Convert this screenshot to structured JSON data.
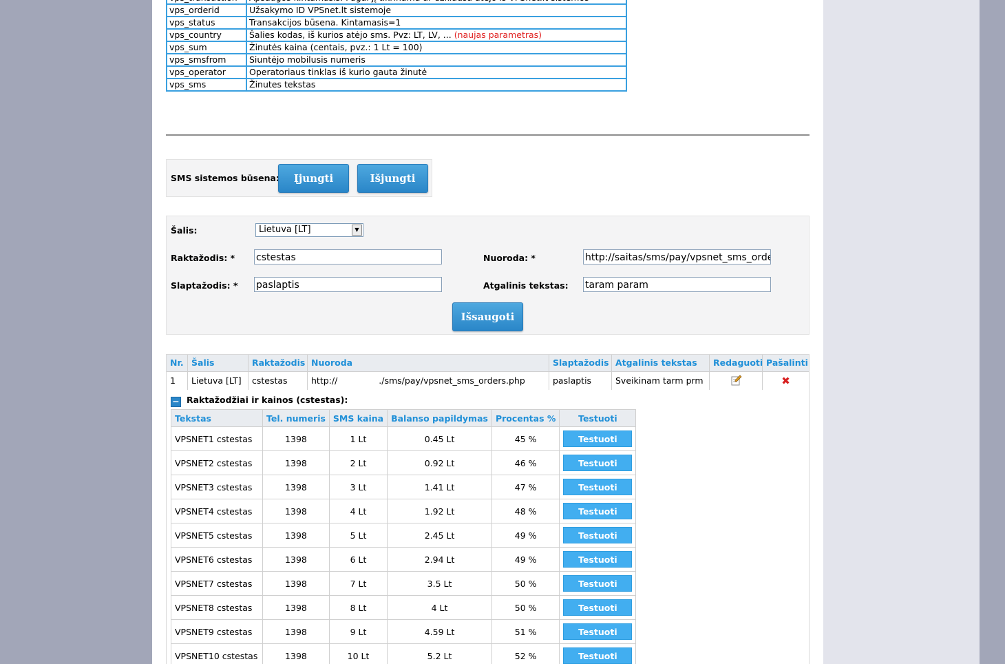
{
  "params": [
    {
      "name": "vps_transaction",
      "desc": "Apsaugos kintamasis. Pagal jį tikrinama ar užklausa atėjo iš VPSnet.lt sistemos",
      "extra": ""
    },
    {
      "name": "vps_orderid",
      "desc": "Užsakymo ID VPSnet.lt sistemoje",
      "extra": ""
    },
    {
      "name": "vps_status",
      "desc": "Transakcijos būsena. Kintamasis=1",
      "extra": ""
    },
    {
      "name": "vps_country",
      "desc": "Šalies kodas, iš kurios atėjo sms. Pvz: LT, LV, ...",
      "extra": "(naujas parametras)"
    },
    {
      "name": "vps_sum",
      "desc": "Žinutės kaina (centais, pvz.: 1 Lt  = 100)",
      "extra": ""
    },
    {
      "name": "vps_smsfrom",
      "desc": "Siuntėjo mobilusis numeris",
      "extra": ""
    },
    {
      "name": "vps_operator",
      "desc": "Operatoriaus tinklas iš kurio gauta žinutė",
      "extra": ""
    },
    {
      "name": "vps_sms",
      "desc": "Žinutes tekstas",
      "extra": ""
    }
  ],
  "status": {
    "label": "SMS sistemos būsena:",
    "on_button": "Įjungti",
    "off_button": "Išjungti"
  },
  "form": {
    "country_label": "Šalis:",
    "country_value": "Lietuva [LT]",
    "keyword_label": "Raktažodis: *",
    "keyword_value": "cstestas",
    "password_label": "Slaptažodis: *",
    "password_value": "paslaptis",
    "url_label": "Nuoroda: *",
    "url_value": "http://saitas/sms/pay/vpsnet_sms_orders.php",
    "reply_label": "Atgalinis tekstas:",
    "reply_value": "taram param",
    "save_button": "Išsaugoti"
  },
  "main_table": {
    "headers": [
      "Nr.",
      "Šalis",
      "Raktažodis",
      "Nuoroda",
      "Slaptažodis",
      "Atgalinis tekstas",
      "Redaguoti",
      "Pašalinti"
    ],
    "row": {
      "nr": "1",
      "country": "Lietuva [LT]",
      "keyword": "cstestas",
      "url_start": "http://",
      "url_end": "./sms/pay/vpsnet_sms_orders.php",
      "password": "paslaptis",
      "reply": "Sveikinam tarm prm",
      "edit_icon": "pencil-icon",
      "delete_icon": "x-icon"
    }
  },
  "sub_section": {
    "title": "Raktažodžiai ir kainos (cstestas):",
    "headers": [
      "Tekstas",
      "Tel. numeris",
      "SMS kaina",
      "Balanso papildymas",
      "Procentas %",
      "Testuoti"
    ],
    "rows": [
      {
        "text": "VPSNET1 cstestas",
        "phone": "1398",
        "price": "1 Lt",
        "balance": "0.45 Lt",
        "percent": "45 %",
        "button": "Testuoti"
      },
      {
        "text": "VPSNET2 cstestas",
        "phone": "1398",
        "price": "2 Lt",
        "balance": "0.92 Lt",
        "percent": "46 %",
        "button": "Testuoti"
      },
      {
        "text": "VPSNET3 cstestas",
        "phone": "1398",
        "price": "3 Lt",
        "balance": "1.41 Lt",
        "percent": "47 %",
        "button": "Testuoti"
      },
      {
        "text": "VPSNET4 cstestas",
        "phone": "1398",
        "price": "4 Lt",
        "balance": "1.92 Lt",
        "percent": "48 %",
        "button": "Testuoti"
      },
      {
        "text": "VPSNET5 cstestas",
        "phone": "1398",
        "price": "5 Lt",
        "balance": "2.45 Lt",
        "percent": "49 %",
        "button": "Testuoti"
      },
      {
        "text": "VPSNET6 cstestas",
        "phone": "1398",
        "price": "6 Lt",
        "balance": "2.94 Lt",
        "percent": "49 %",
        "button": "Testuoti"
      },
      {
        "text": "VPSNET7 cstestas",
        "phone": "1398",
        "price": "7 Lt",
        "balance": "3.5 Lt",
        "percent": "50 %",
        "button": "Testuoti"
      },
      {
        "text": "VPSNET8 cstestas",
        "phone": "1398",
        "price": "8 Lt",
        "balance": "4 Lt",
        "percent": "50 %",
        "button": "Testuoti"
      },
      {
        "text": "VPSNET9 cstestas",
        "phone": "1398",
        "price": "9 Lt",
        "balance": "4.59 Lt",
        "percent": "51 %",
        "button": "Testuoti"
      },
      {
        "text": "VPSNET10 cstestas",
        "phone": "1398",
        "price": "10 Lt",
        "balance": "5.2 Lt",
        "percent": "52 %",
        "button": "Testuoti"
      }
    ]
  },
  "colors": {
    "background": "#a2a6b8",
    "accent": "#2090d8",
    "button": "#42aef0",
    "border": "#3aa0e0",
    "new_param": "#e02020"
  }
}
